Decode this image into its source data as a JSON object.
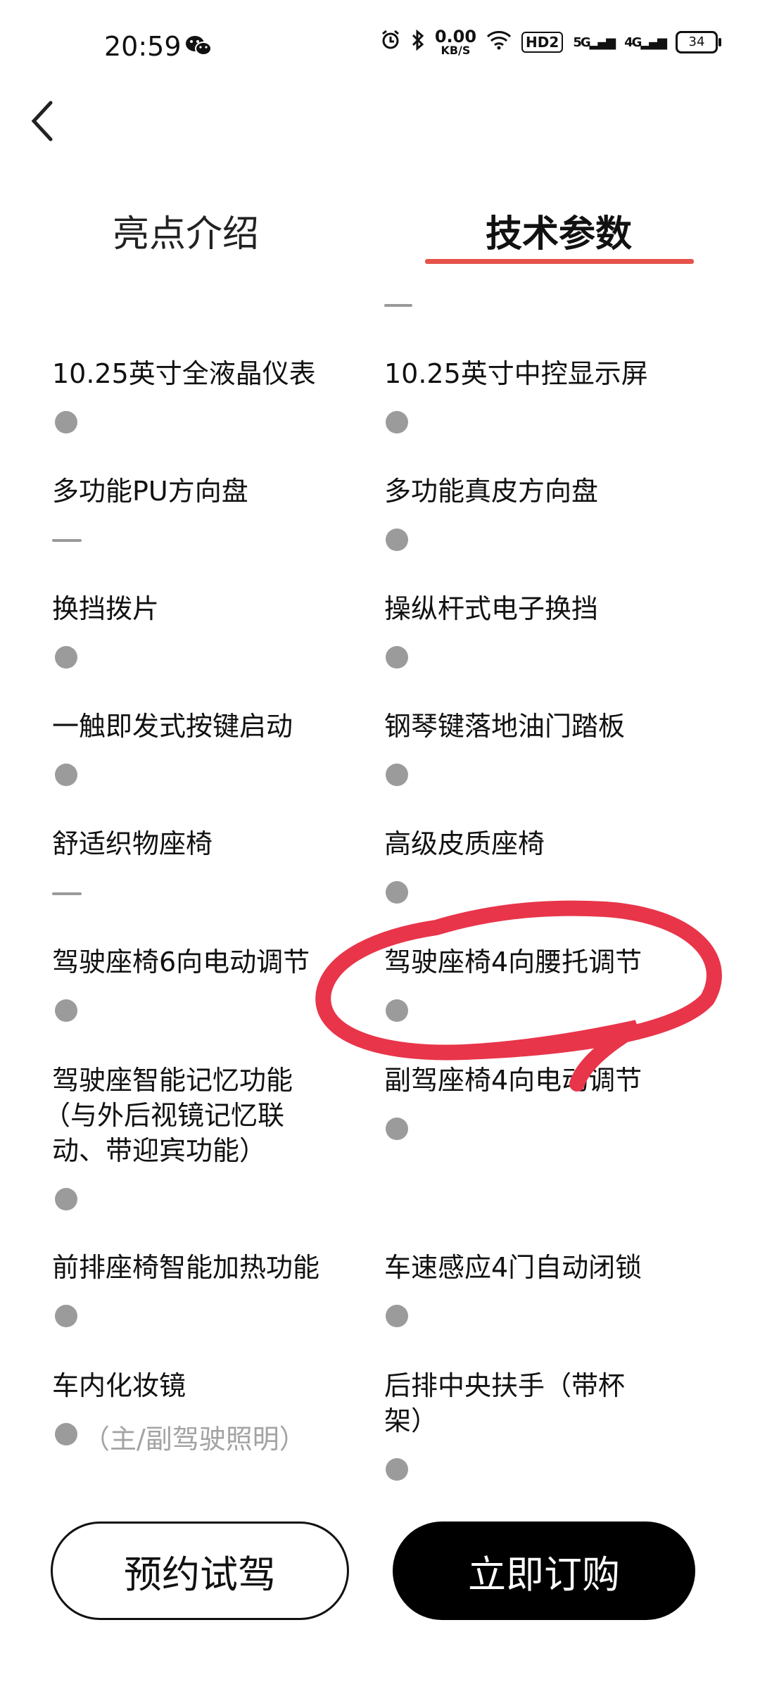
{
  "status_bar": {
    "time": "20:59",
    "net_speed_value": "0.00",
    "net_speed_unit": "KB/S",
    "hd_badge": "HD2",
    "sig1": "5G",
    "sig2": "4G",
    "battery": "34",
    "icons": [
      "wechat-icon",
      "alarm-icon",
      "bluetooth-icon",
      "wifi-icon",
      "signal-icon",
      "battery-icon"
    ]
  },
  "nav": {
    "back_icon": "back-chevron-icon"
  },
  "tabs": [
    {
      "label": "亮点介绍",
      "active": false
    },
    {
      "label": "技术参数",
      "active": true
    }
  ],
  "accent_color": "#e5534b",
  "features": [
    {
      "label": "10.25英寸全液晶仪表",
      "mark": "dot"
    },
    {
      "label": "10.25英寸中控显示屏",
      "mark": "dot"
    },
    {
      "label": "多功能PU方向盘",
      "mark": "dash"
    },
    {
      "label": "多功能真皮方向盘",
      "mark": "dot"
    },
    {
      "label": "换挡拨片",
      "mark": "dot"
    },
    {
      "label": "操纵杆式电子换挡",
      "mark": "dot"
    },
    {
      "label": "一触即发式按键启动",
      "mark": "dot"
    },
    {
      "label": "钢琴键落地油门踏板",
      "mark": "dot"
    },
    {
      "label": "舒适织物座椅",
      "mark": "dash"
    },
    {
      "label": "高级皮质座椅",
      "mark": "dot"
    },
    {
      "label": "驾驶座椅6向电动调节",
      "mark": "dot"
    },
    {
      "label": "驾驶座椅4向腰托调节",
      "mark": "dot"
    },
    {
      "label_lines": [
        "驾驶座智能记忆功能",
        "（与外后视镜记忆联",
        "动、带迎宾功能）"
      ],
      "mark": "dot"
    },
    {
      "label": "副驾座椅4向电动调节",
      "mark": "dot"
    },
    {
      "label": "前排座椅智能加热功能",
      "mark": "dot"
    },
    {
      "label": "车速感应4门自动闭锁",
      "mark": "dot"
    },
    {
      "label": "车内化妆镜",
      "mark": "dot",
      "note": "（主/副驾驶照明）"
    },
    {
      "label_lines": [
        "后排中央扶手（带杯",
        "架）"
      ],
      "mark": "dot"
    }
  ],
  "annotation": {
    "color": "#e8354a",
    "description_icon": "red-circle-annotation"
  },
  "buttons": {
    "test_drive": "预约试驾",
    "buy_now": "立即订购"
  }
}
